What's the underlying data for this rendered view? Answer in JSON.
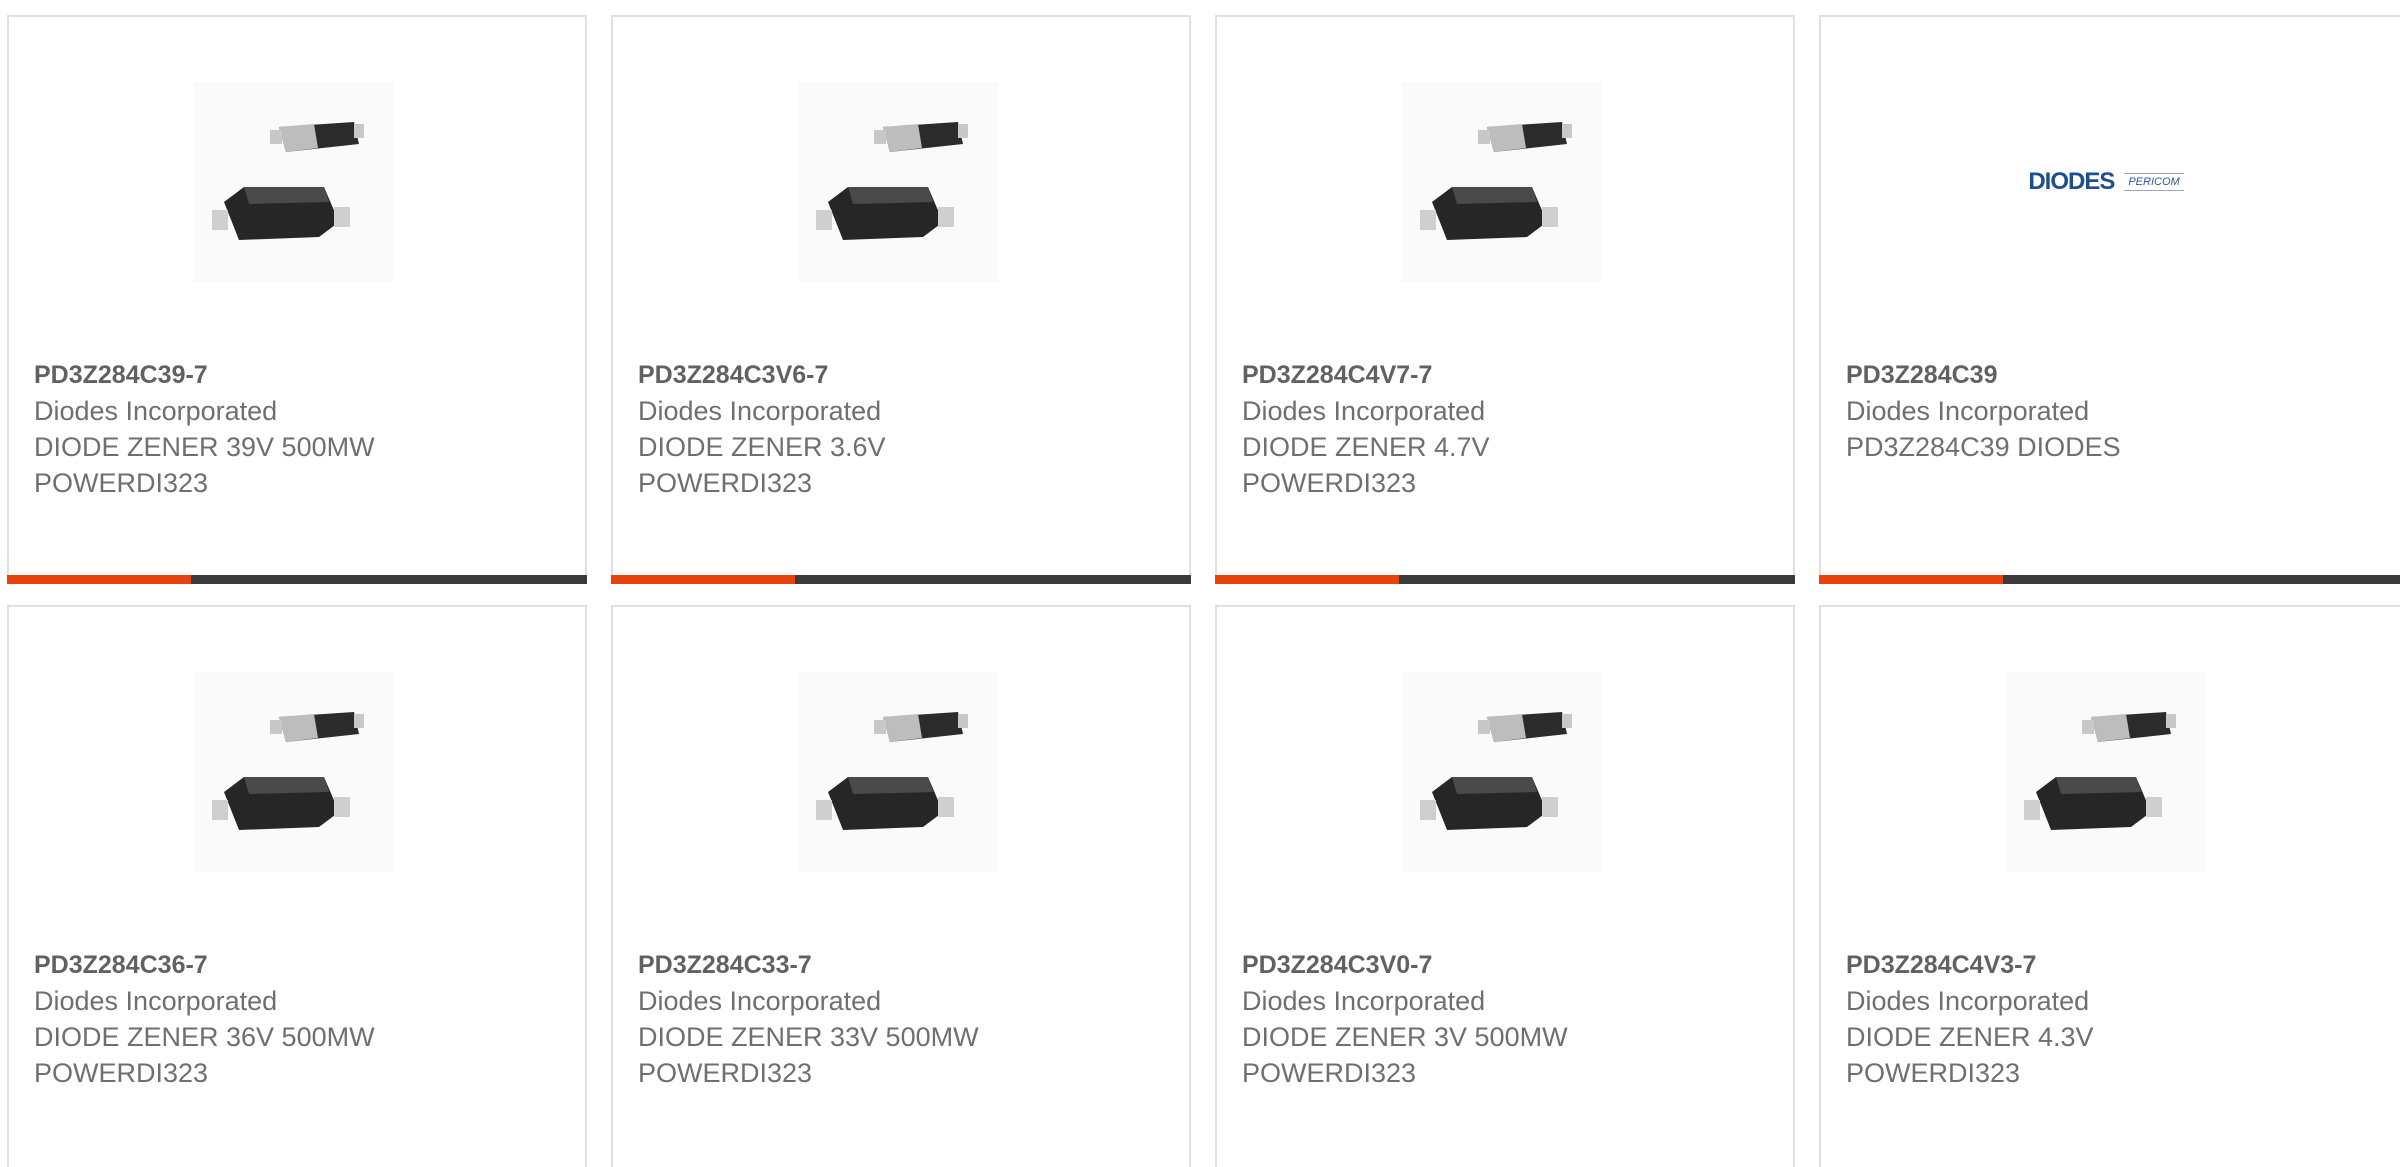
{
  "products": [
    {
      "part": "PD3Z284C39-7",
      "maker": "Diodes Incorporated",
      "desc1": "DIODE ZENER 39V 500MW",
      "desc2": "POWERDI323",
      "image": "diode-package-icon"
    },
    {
      "part": "PD3Z284C3V6-7",
      "maker": "Diodes Incorporated",
      "desc1": "DIODE ZENER 3.6V",
      "desc2": "POWERDI323",
      "image": "diode-package-icon"
    },
    {
      "part": "PD3Z284C4V7-7",
      "maker": "Diodes Incorporated",
      "desc1": "DIODE ZENER 4.7V",
      "desc2": "POWERDI323",
      "image": "diode-package-icon"
    },
    {
      "part": "PD3Z284C39",
      "maker": "Diodes Incorporated",
      "desc1": "PD3Z284C39 DIODES",
      "desc2": "",
      "image": "diodes-pericom-logo",
      "logo_text": "DIODES",
      "logo_sub": "PERICOM"
    },
    {
      "part": "PD3Z284C36-7",
      "maker": "Diodes Incorporated",
      "desc1": "DIODE ZENER 36V 500MW",
      "desc2": "POWERDI323",
      "image": "diode-package-icon"
    },
    {
      "part": "PD3Z284C33-7",
      "maker": "Diodes Incorporated",
      "desc1": "DIODE ZENER 33V 500MW",
      "desc2": "POWERDI323",
      "image": "diode-package-icon"
    },
    {
      "part": "PD3Z284C3V0-7",
      "maker": "Diodes Incorporated",
      "desc1": "DIODE ZENER 3V 500MW",
      "desc2": "POWERDI323",
      "image": "diode-package-icon"
    },
    {
      "part": "PD3Z284C4V3-7",
      "maker": "Diodes Incorporated",
      "desc1": "DIODE ZENER 4.3V",
      "desc2": "POWERDI323",
      "image": "diode-package-icon"
    }
  ],
  "colors": {
    "accent": "#e8430c",
    "bar": "#3a3a3a",
    "border": "#e0e0e0",
    "text": "#6f6f6f"
  }
}
